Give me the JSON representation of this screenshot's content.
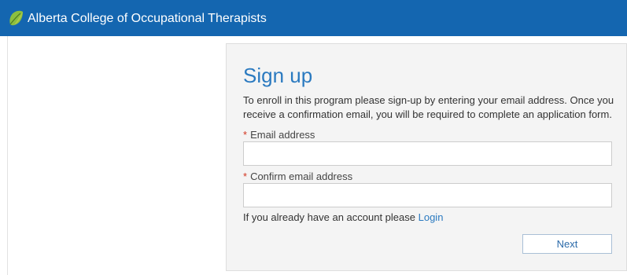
{
  "header": {
    "title": "Alberta College of Occupational Therapists",
    "logo_icon": "leaf-logo-icon",
    "bg_color": "#1466b0"
  },
  "form": {
    "title": "Sign up",
    "intro_line1": "To enroll in this program please sign-up by entering your email address. Once you",
    "intro_line2": "receive a confirmation email, you will be required to complete an application form.",
    "required_marker": "*",
    "email_label": "Email address",
    "email_value": "",
    "confirm_label": "Confirm email address",
    "confirm_value": "",
    "login_prompt": "If you already have an account please",
    "login_link": "Login",
    "next_label": "Next"
  }
}
